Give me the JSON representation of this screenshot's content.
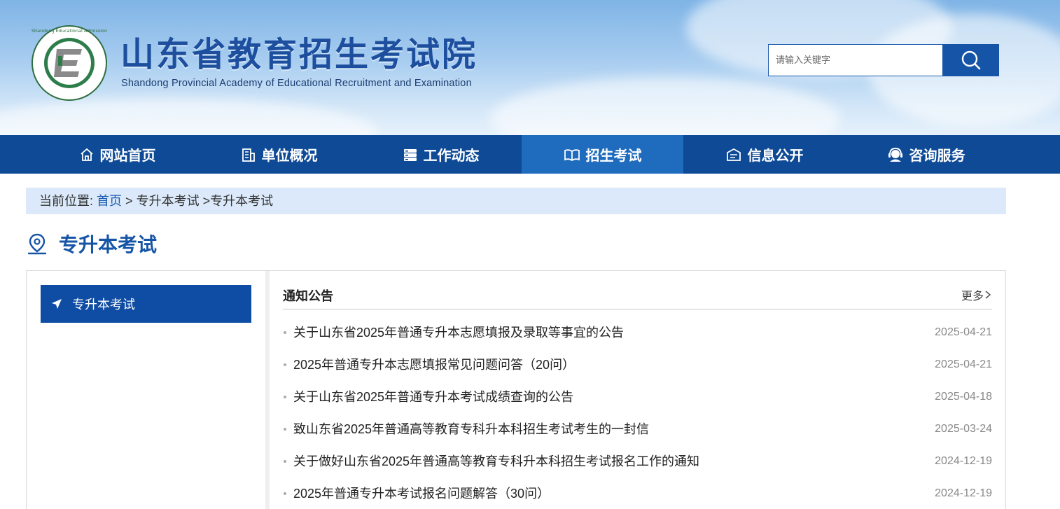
{
  "header": {
    "title": "山东省教育招生考试院",
    "subtitle": "Shandong Provincial Academy of Educational Recruitment and Examination",
    "seal_text": "Shandong Educational Admission & Examination",
    "search": {
      "placeholder": "请输入关键字"
    }
  },
  "nav": {
    "items": [
      {
        "label": "网站首页",
        "icon": "home-icon"
      },
      {
        "label": "单位概况",
        "icon": "building-icon"
      },
      {
        "label": "工作动态",
        "icon": "news-icon"
      },
      {
        "label": "招生考试",
        "icon": "book-icon",
        "active": true
      },
      {
        "label": "信息公开",
        "icon": "info-icon"
      },
      {
        "label": "咨询服务",
        "icon": "headset-icon"
      }
    ]
  },
  "breadcrumb": {
    "prefix": "当前位置:",
    "home": "首页",
    "sep1": ">",
    "level1": "专升本考试",
    "sep2": ">",
    "level2": "专升本考试"
  },
  "page": {
    "title": "专升本考试"
  },
  "sidebar": {
    "items": [
      {
        "label": "专升本考试"
      }
    ]
  },
  "panel": {
    "title": "通知公告",
    "more": "更多",
    "items": [
      {
        "title": "关于山东省2025年普通专升本志愿填报及录取等事宜的公告",
        "date": "2025-04-21"
      },
      {
        "title": "2025年普通专升本志愿填报常见问题问答（20问）",
        "date": "2025-04-21"
      },
      {
        "title": "关于山东省2025年普通专升本考试成绩查询的公告",
        "date": "2025-04-18"
      },
      {
        "title": "致山东省2025年普通高等教育专科升本科招生考试考生的一封信",
        "date": "2025-03-24"
      },
      {
        "title": "关于做好山东省2025年普通高等教育专科升本科招生考试报名工作的通知",
        "date": "2024-12-19"
      },
      {
        "title": "2025年普通专升本考试报名问题解答（30问）",
        "date": "2024-12-19"
      }
    ]
  },
  "colors": {
    "primary": "#0e4a96",
    "active_nav": "#1f6bbd",
    "breadcrumb_bg": "#dbe9fa",
    "title_blue": "#1554a6"
  }
}
